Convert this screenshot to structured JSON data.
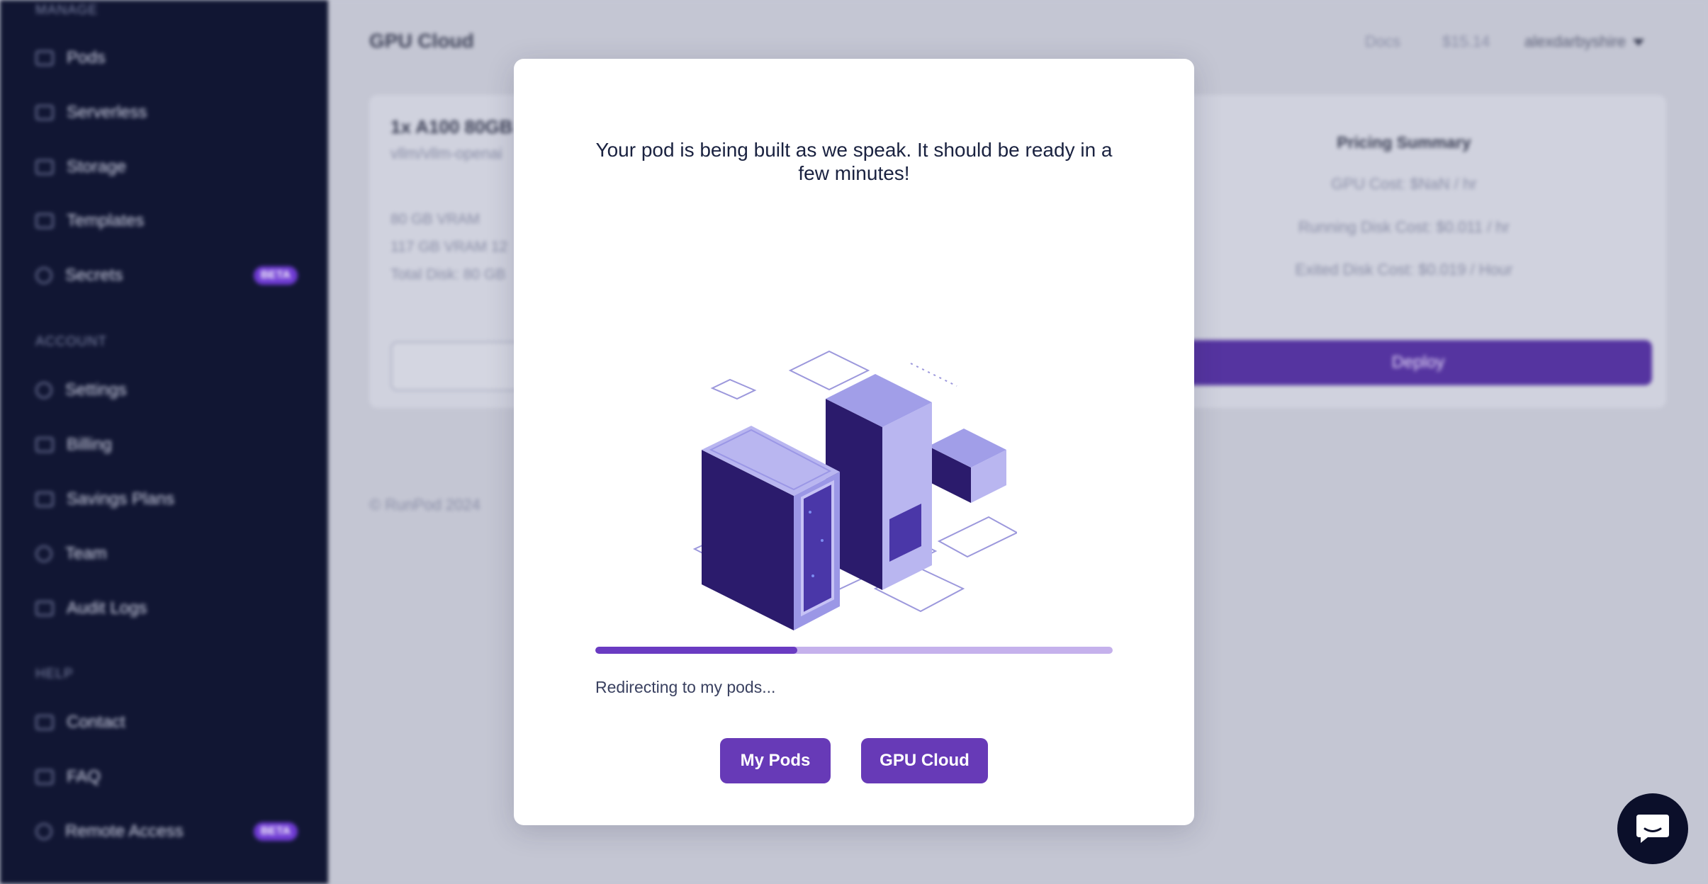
{
  "sidebar": {
    "sections": {
      "manage": "MANAGE",
      "account": "ACCOUNT",
      "help": "HELP"
    },
    "items": [
      {
        "label": "Pods"
      },
      {
        "label": "Serverless"
      },
      {
        "label": "Storage"
      },
      {
        "label": "Templates"
      },
      {
        "label": "Secrets",
        "badge": "BETA"
      },
      {
        "label": "Settings"
      },
      {
        "label": "Billing"
      },
      {
        "label": "Savings Plans"
      },
      {
        "label": "Team"
      },
      {
        "label": "Audit Logs"
      },
      {
        "label": "Contact"
      },
      {
        "label": "FAQ"
      },
      {
        "label": "Remote Access",
        "badge": "BETA"
      }
    ]
  },
  "header": {
    "title": "GPU Cloud",
    "docs": "Docs",
    "balance": "$15.14",
    "user": "alexdarbyshire"
  },
  "card": {
    "title": "1x A100 80GB",
    "subtitle": "vllm/vllm-openai",
    "specs": [
      "80 GB VRAM",
      "117 GB VRAM 12",
      "Total Disk: 80 GB"
    ]
  },
  "pricing": {
    "title": "Pricing Summary",
    "gpu_cost": "GPU Cost: $NaN / hr",
    "running_disk": "Running Disk Cost: $0.011 / hr",
    "exited_disk": "Exited Disk Cost: $0.019 / Hour",
    "deploy": "Deploy"
  },
  "footer": "© RunPod 2024",
  "modal": {
    "message": "Your pod is being built as we speak. It should be ready in a few minutes!",
    "progress": 0.39,
    "redirect": "Redirecting to my pods...",
    "my_pods": "My Pods",
    "gpu_cloud": "GPU Cloud"
  },
  "colors": {
    "primary": "#673ab7",
    "sidebar_bg": "#111633",
    "progress_track": "#c5b1ec",
    "progress_fill": "#6a3bc2"
  },
  "icons": [
    "chat-icon"
  ]
}
